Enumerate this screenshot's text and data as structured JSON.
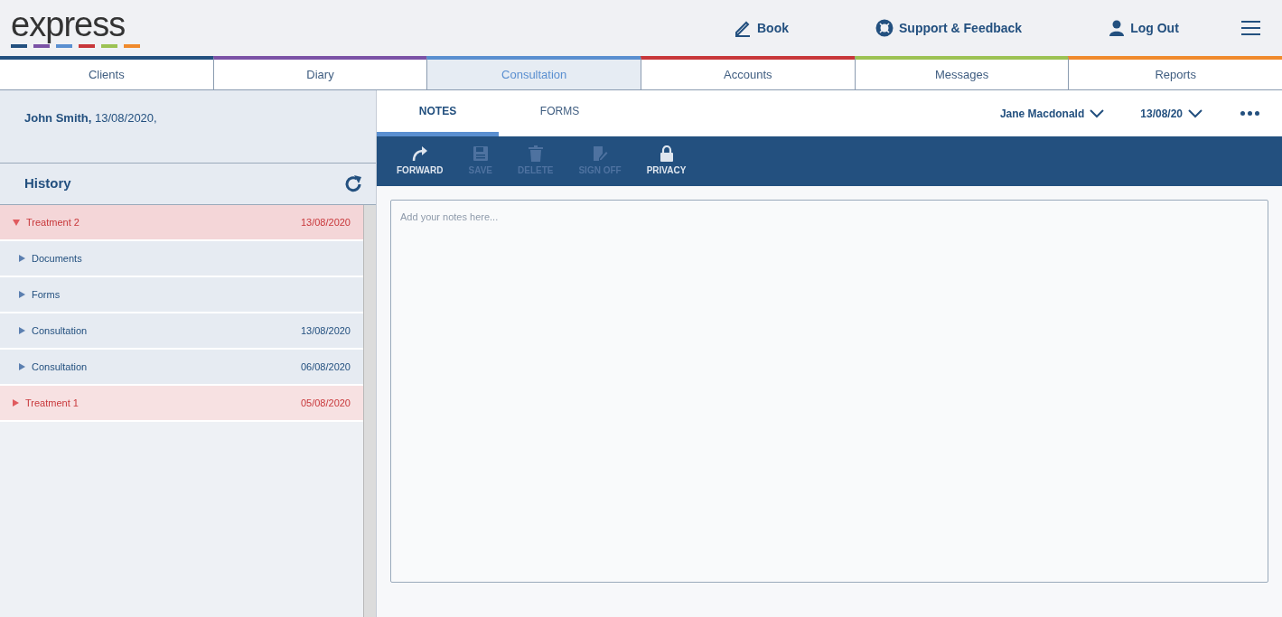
{
  "logo": {
    "text": "express"
  },
  "header_links": [
    {
      "kind": "book",
      "label": "Book"
    },
    {
      "kind": "support",
      "label": "Support & Feedback"
    },
    {
      "kind": "logout",
      "label": "Log Out"
    }
  ],
  "nav_tabs": [
    {
      "label": "Clients",
      "color": "#23507f",
      "selected": false
    },
    {
      "label": "Diary",
      "color": "#7b52a6",
      "selected": false
    },
    {
      "label": "Consultation",
      "color": "#5a8fd0",
      "selected": true
    },
    {
      "label": "Accounts",
      "color": "#c8373a",
      "selected": false
    },
    {
      "label": "Messages",
      "color": "#9cc253",
      "selected": false
    },
    {
      "label": "Reports",
      "color": "#f08a2c",
      "selected": false
    }
  ],
  "patient": {
    "name": "John Smith,",
    "details": "13/08/2020,"
  },
  "history": {
    "title": "History",
    "items": [
      {
        "label": "Treatment 2",
        "date": "13/08/2020",
        "expanded": true,
        "children": [
          {
            "label": "Documents",
            "expanded": false
          },
          {
            "label": "Forms",
            "expanded": false
          },
          {
            "label": "Consultation",
            "date": "13/08/2020",
            "expanded": false
          },
          {
            "label": "Consultation",
            "date": "06/08/2020",
            "expanded": false
          }
        ]
      },
      {
        "label": "Treatment 1",
        "date": "05/08/2020",
        "expanded": false
      }
    ]
  },
  "content_tabs": [
    {
      "label": "NOTES",
      "selected": true
    },
    {
      "label": "FORMS",
      "selected": false
    }
  ],
  "clinician": "Jane Macdonald",
  "date_select": "13/08/20",
  "toolbar": [
    {
      "kind": "forward",
      "label": "FORWARD",
      "disabled": false
    },
    {
      "kind": "save",
      "label": "SAVE",
      "disabled": true
    },
    {
      "kind": "delete",
      "label": "DELETE",
      "disabled": true
    },
    {
      "kind": "signoff",
      "label": "SIGN OFF",
      "disabled": true
    },
    {
      "kind": "privacy",
      "label": "PRIVACY",
      "disabled": false
    }
  ],
  "notes": {
    "placeholder": "Add your notes here..."
  }
}
